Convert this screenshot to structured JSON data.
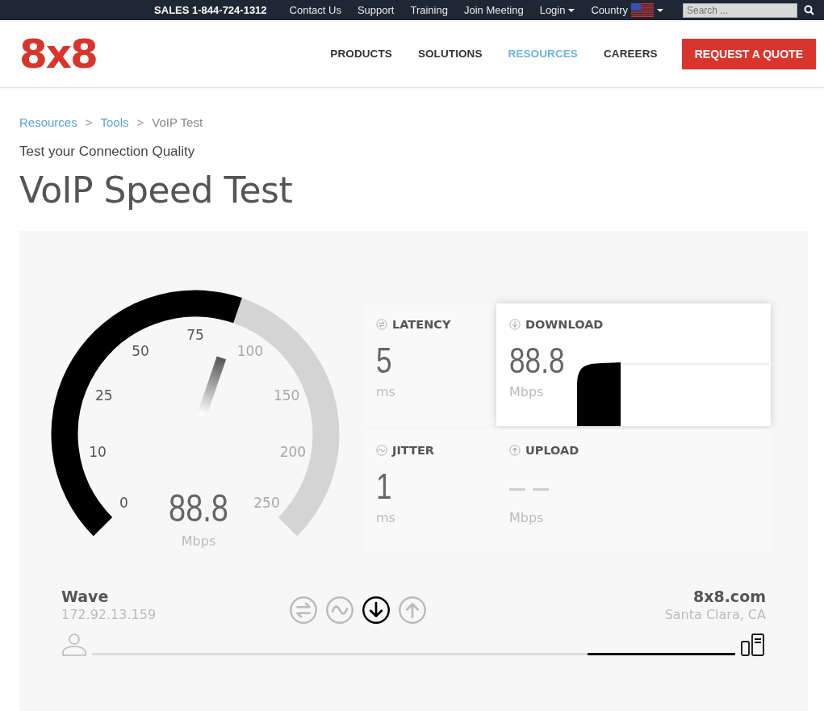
{
  "top_bar": {
    "sales": "SALES 1-844-724-1312",
    "links": [
      {
        "label": "Contact Us",
        "kind": "link"
      },
      {
        "label": "Support",
        "kind": "link"
      },
      {
        "label": "Training",
        "kind": "link"
      },
      {
        "label": "Join Meeting",
        "kind": "link"
      },
      {
        "label": "Login",
        "kind": "menu"
      },
      {
        "label": "Country",
        "kind": "country"
      }
    ],
    "search": {
      "placeholder": "Search ..."
    }
  },
  "header": {
    "logo": "8x8",
    "nav": [
      {
        "label": "PRODUCTS",
        "selected": false
      },
      {
        "label": "SOLUTIONS",
        "selected": false
      },
      {
        "label": "RESOURCES",
        "selected": true
      },
      {
        "label": "CAREERS",
        "selected": false
      }
    ],
    "cta": "REQUEST A QUOTE"
  },
  "breadcrumb": [
    {
      "kind": "link",
      "text": "Resources"
    },
    {
      "kind": "separator",
      "text": ">"
    },
    {
      "kind": "link",
      "text": "Tools"
    },
    {
      "kind": "separator",
      "text": ">"
    },
    {
      "kind": "current",
      "text": "VoIP Test"
    }
  ],
  "subtitle": "Test your Connection Quality",
  "title": "VoIP Speed Test",
  "gauge": {
    "level": 0.57,
    "ticks": [
      {
        "label": "0",
        "reached": true
      },
      {
        "label": "10",
        "reached": true
      },
      {
        "label": "25",
        "reached": true
      },
      {
        "label": "50",
        "reached": true
      },
      {
        "label": "75",
        "reached": true
      },
      {
        "label": "100",
        "reached": false
      },
      {
        "label": "150",
        "reached": false
      },
      {
        "label": "200",
        "reached": false
      },
      {
        "label": "250",
        "reached": false
      }
    ],
    "value": "88.8",
    "unit": "Mbps"
  },
  "metrics": [
    {
      "kind": "latency",
      "label": "LATENCY",
      "value": "5",
      "unit": "ms",
      "selected": false
    },
    {
      "kind": "download",
      "label": "DOWNLOAD",
      "value": "88.8",
      "unit": "Mbps",
      "selected": true
    },
    {
      "kind": "jitter",
      "label": "JITTER",
      "value": "1",
      "unit": "ms",
      "selected": false
    },
    {
      "kind": "upload",
      "label": "UPLOAD",
      "value": "– –",
      "unit": "Mbps",
      "selected": false
    }
  ],
  "client": {
    "name": "Wave",
    "ip": "172.92.13.159"
  },
  "steps": [
    {
      "kind": "latency",
      "selected": false
    },
    {
      "kind": "jitter",
      "selected": false
    },
    {
      "kind": "download",
      "selected": true
    },
    {
      "kind": "upload",
      "selected": false
    }
  ],
  "server": {
    "name": "8x8.com",
    "location": "Santa Clara, CA"
  },
  "connection": {
    "level": 0.23
  }
}
